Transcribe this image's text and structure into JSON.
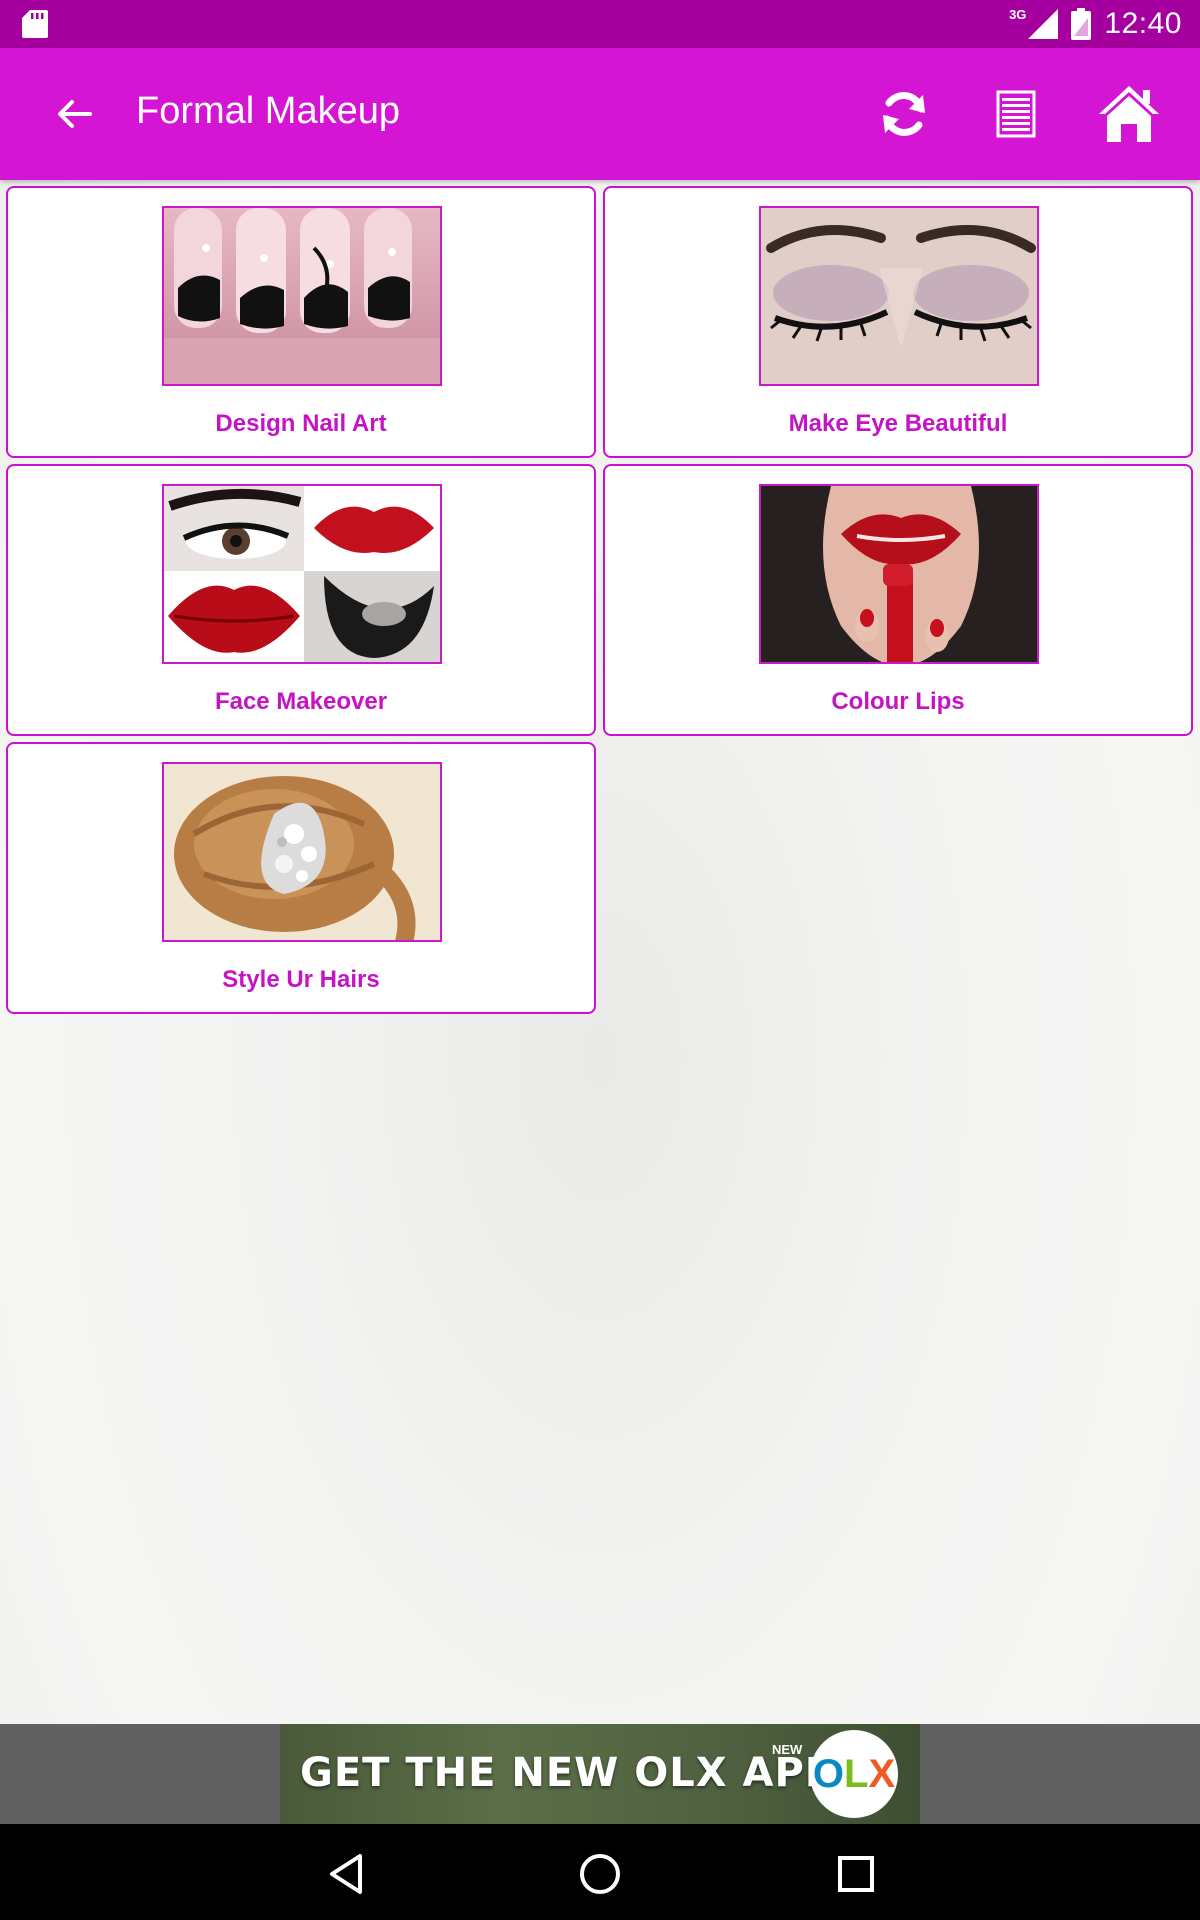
{
  "status_bar": {
    "network_label": "3G",
    "time": "12:40"
  },
  "app_bar": {
    "title": "Formal Makeup"
  },
  "cards": [
    {
      "label": "Design Nail Art"
    },
    {
      "label": "Make Eye Beautiful"
    },
    {
      "label": "Face Makeover"
    },
    {
      "label": "Colour Lips"
    },
    {
      "label": "Style Ur Hairs"
    }
  ],
  "ad": {
    "text": "GET THE NEW OLX APP",
    "badge": "NEW",
    "logo": "OLX"
  },
  "colors": {
    "status_bar": "#a5009f",
    "app_bar": "#d415d4",
    "accent": "#c514c5"
  }
}
